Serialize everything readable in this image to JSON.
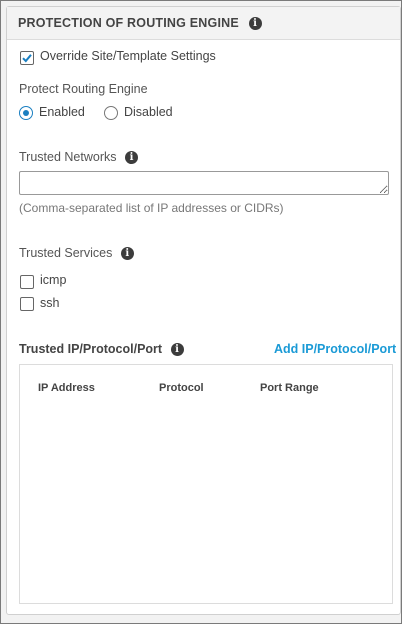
{
  "panel": {
    "title": "PROTECTION OF ROUTING ENGINE",
    "title_icon": "info-icon"
  },
  "override": {
    "label": "Override Site/Template Settings",
    "checked": true
  },
  "protect": {
    "label": "Protect Routing Engine",
    "options": [
      {
        "label": "Enabled",
        "selected": true
      },
      {
        "label": "Disabled",
        "selected": false
      }
    ]
  },
  "trusted_networks": {
    "label": "Trusted Networks",
    "value": "",
    "hint": "(Comma-separated list of IP addresses or CIDRs)"
  },
  "trusted_services": {
    "label": "Trusted Services",
    "items": [
      {
        "label": "icmp",
        "checked": false
      },
      {
        "label": "ssh",
        "checked": false
      }
    ]
  },
  "trusted_ipp": {
    "label": "Trusted IP/Protocol/Port",
    "add_label": "Add IP/Protocol/Port",
    "columns": [
      "IP Address",
      "Protocol",
      "Port Range"
    ],
    "rows": []
  },
  "colors": {
    "accent": "#1a7fc1",
    "link": "#1a9ad6",
    "header_bg": "#f3f3f3"
  }
}
